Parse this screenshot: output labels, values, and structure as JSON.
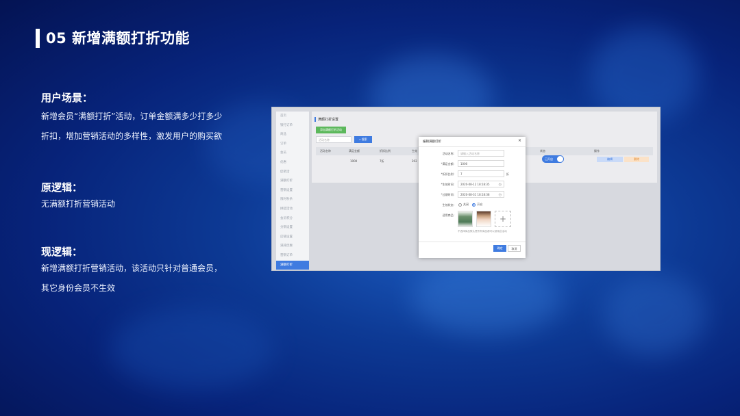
{
  "slide": {
    "title": "05 新增满额打折功能",
    "sections": [
      {
        "heading": "用户场景：",
        "lines": [
          "新增会员“满额打折”活动，订单金额满多少打多少",
          "折扣，增加营销活动的多样性，激发用户的购买欲"
        ]
      },
      {
        "heading": "原逻辑：",
        "lines": [
          "无满额打折营销活动"
        ]
      },
      {
        "heading": "现逻辑：",
        "lines": [
          "新增满额打折营销活动，该活动只针对普通会员，",
          "其它身份会员不生效"
        ]
      }
    ]
  },
  "screenshot": {
    "sidebar": {
      "items": [
        "首页",
        "银行订单",
        "商品",
        "订单",
        "会员",
        "优惠",
        "促销活",
        "满额打折",
        "营销设置",
        "限时秒杀",
        "拼团活动",
        "会员积分",
        "分销设置",
        "店铺设置",
        "满减优惠",
        "营销订单",
        "满额打折",
        "设置"
      ],
      "active_index": 16
    },
    "panel_title": "满额打折设置",
    "add_button": "添加满额打折活动",
    "search_placeholder": "活动名称",
    "search_button": "搜索",
    "table": {
      "headers": [
        "活动名称",
        "满足金额",
        "折扣比例",
        "生效",
        "状态",
        "操作"
      ],
      "row": {
        "amount": "1000",
        "discount": "7折",
        "date": "202",
        "status": "已开启",
        "edit": "编辑",
        "delete": "删除"
      }
    },
    "modal": {
      "title": "编辑满额打折",
      "close": "×",
      "fields": {
        "name": {
          "label": "活动名称:",
          "placeholder": "请输入活动名称"
        },
        "amount": {
          "label": "*满足金额:",
          "value": "1000"
        },
        "discount": {
          "label": "*折扣比例:",
          "value": "7",
          "unit": "折"
        },
        "start": {
          "label": "*生效时间:",
          "value": "2020-08-12 18:18:35"
        },
        "end": {
          "label": "*过期时间:",
          "value": "2020-08-31 18:18:38"
        },
        "status": {
          "label": "生效状态:",
          "options": [
            "关闭",
            "开启"
          ],
          "selected": "开启"
        },
        "goods": {
          "label": "适用商品:",
          "hint": "不选择商品默认是所有商品都可以使用此活动"
        }
      },
      "ok": "确定",
      "cancel": "取消"
    }
  }
}
